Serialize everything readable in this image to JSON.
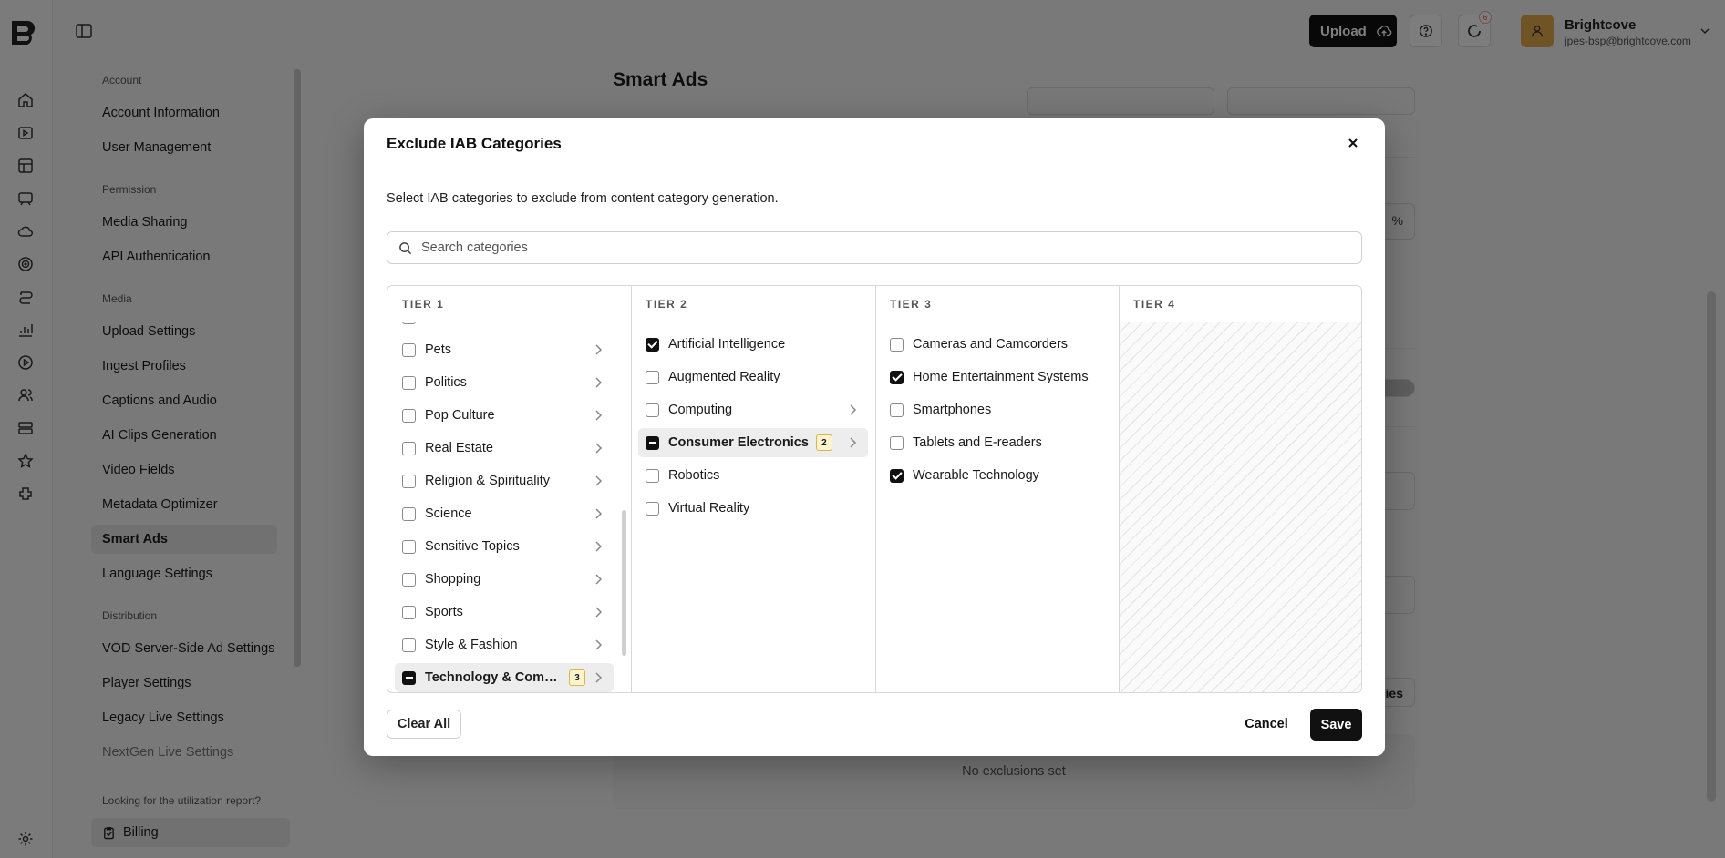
{
  "topbar": {
    "upload_label": "Upload",
    "notification_count": "6",
    "user_name": "Brightcove",
    "user_email": "jpes-bsp@brightcove.com"
  },
  "rail_icons": [
    "home-icon",
    "video-icon",
    "playlist-icon",
    "message-icon",
    "cloud-icon",
    "target-icon",
    "money-icon",
    "analytics-icon",
    "play-icon",
    "audience-icon",
    "server-icon",
    "star-icon",
    "plugins-icon"
  ],
  "subnav": {
    "sections": {
      "account": "Account",
      "permission": "Permission",
      "media": "Media",
      "distribution": "Distribution"
    },
    "items": {
      "account_information": "Account Information",
      "user_management": "User Management",
      "media_sharing": "Media Sharing",
      "api_authentication": "API Authentication",
      "upload_settings": "Upload Settings",
      "ingest_profiles": "Ingest Profiles",
      "captions_and_audio": "Captions and Audio",
      "ai_clips_generation": "AI Clips Generation",
      "video_fields": "Video Fields",
      "metadata_optimizer": "Metadata Optimizer",
      "smart_ads": "Smart Ads",
      "language_settings": "Language Settings",
      "vod_ssai": "VOD Server-Side Ad Settings",
      "player_settings": "Player Settings",
      "legacy_live": "Legacy Live Settings",
      "nextgen_live": "NextGen Live Settings"
    },
    "utilization_prompt": "Looking for the utilization report?",
    "billing_label": "Billing"
  },
  "main": {
    "title": "Smart Ads",
    "empty_state": "No exclusions set",
    "ghost_percent": "%",
    "ghost_button_tail": "ies"
  },
  "modal": {
    "title": "Exclude IAB Categories",
    "description": "Select IAB categories to exclude from content category generation.",
    "search_placeholder": "Search categories",
    "tier_headers": [
      "TIER 1",
      "TIER 2",
      "TIER 3",
      "TIER 4"
    ],
    "tier1": [
      {
        "label": "Pets",
        "state": "unchecked"
      },
      {
        "label": "Politics",
        "state": "unchecked"
      },
      {
        "label": "Pop Culture",
        "state": "unchecked"
      },
      {
        "label": "Real Estate",
        "state": "unchecked"
      },
      {
        "label": "Religion & Spirituality",
        "state": "unchecked"
      },
      {
        "label": "Science",
        "state": "unchecked"
      },
      {
        "label": "Sensitive Topics",
        "state": "unchecked"
      },
      {
        "label": "Shopping",
        "state": "unchecked"
      },
      {
        "label": "Sports",
        "state": "unchecked"
      },
      {
        "label": "Style & Fashion",
        "state": "unchecked"
      },
      {
        "label": "Technology & Computing",
        "state": "partial",
        "badge": "3",
        "selected": true
      }
    ],
    "tier2": [
      {
        "label": "Artificial Intelligence",
        "state": "checked"
      },
      {
        "label": "Augmented Reality",
        "state": "unchecked"
      },
      {
        "label": "Computing",
        "state": "unchecked",
        "has_children": true
      },
      {
        "label": "Consumer Electronics",
        "state": "partial",
        "badge": "2",
        "selected": true
      },
      {
        "label": "Robotics",
        "state": "unchecked"
      },
      {
        "label": "Virtual Reality",
        "state": "unchecked"
      }
    ],
    "tier3": [
      {
        "label": "Cameras and Camcorders",
        "state": "unchecked"
      },
      {
        "label": "Home Entertainment Systems",
        "state": "checked"
      },
      {
        "label": "Smartphones",
        "state": "unchecked"
      },
      {
        "label": "Tablets and E-readers",
        "state": "unchecked"
      },
      {
        "label": "Wearable Technology",
        "state": "checked"
      }
    ],
    "clear_all_label": "Clear All",
    "cancel_label": "Cancel",
    "save_label": "Save"
  }
}
